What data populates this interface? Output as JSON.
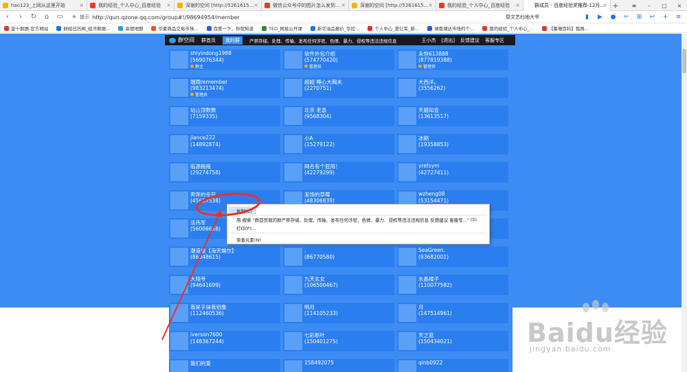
{
  "browser": {
    "tabs": [
      {
        "label": "hao123_上网从这里开始",
        "color": "#f5b400"
      },
      {
        "label": "我的经验_个人中心_百度经验",
        "color": "#e23b2e"
      },
      {
        "label": "深谢的空间 [http://526161584.qzone.qq.com]",
        "color": "#f5b400"
      },
      {
        "label": "微信公众号中的图片怎么发到电脑上_百度经验",
        "color": "#e23b2e"
      },
      {
        "label": "深谢的空间 [http://526161584.qzone.qq.com]",
        "color": "#f5b400"
      },
      {
        "label": "我的经验_个人中心_百度经验",
        "color": "#e23b2e"
      },
      {
        "label": "群成员 - 百度经验奖推荐-12月 - 群",
        "color": "#ffffff",
        "active": true
      }
    ],
    "tab_add": "+",
    "window_controls": [
      "≡",
      "–",
      "□",
      "×"
    ],
    "nav": {
      "back": "‹",
      "forward": "›",
      "reload": "↻",
      "home": "⌂",
      "reader": "▭"
    },
    "address": {
      "tip": "提示",
      "url": "http://qun.qzone.qq.com/group#!/98694954/member"
    },
    "search": {
      "value": "昼文艺扫地大爷"
    },
    "toolbar_icons": [
      "▮",
      "▶",
      "●",
      "✂",
      "⊞",
      "↩",
      "+",
      "≡"
    ],
    "bookmarks": [
      {
        "label": "金十数据-官方网站",
        "color": "#d9362b"
      },
      {
        "label": "财经日历网_经济数据...",
        "color": "#1a73e8"
      },
      {
        "label": "高德地图",
        "color": "#2d9cdb"
      },
      {
        "label": "华夏商品交易市场...",
        "color": "#e8542e"
      },
      {
        "label": "百度一下，你就知道",
        "color": "#2a5bd7"
      },
      {
        "label": "TED_网易公开课",
        "color": "#2c8a3c"
      },
      {
        "label": "新华油品报价_华控...",
        "color": "#1a73e8"
      },
      {
        "label": "个人中心_爱亿军_新...",
        "color": "#d9362b"
      },
      {
        "label": "湖南湖达市场的个...",
        "color": "#2a5bd7"
      },
      {
        "label": "我的经验_个人中心_...",
        "color": "#e23b2e"
      },
      {
        "label": "【鲁珊百科】我再...",
        "color": "#d9362b"
      }
    ]
  },
  "qzone_nav": {
    "logo": "群空间",
    "items": [
      "群首页",
      "我的群",
      "产禁存储、处理、传输、发布任何涉密、色情、暴力、侵权等违法违规信息"
    ],
    "right": [
      "王小杰",
      "[退出]",
      "反馈建议",
      "客服专区"
    ]
  },
  "members": [
    [
      {
        "name": "shiyindong1988",
        "qq": "(569076344)",
        "role": "群主"
      },
      {
        "name": "软件外包介绍",
        "qq": "(574770420)",
        "role": "管理员"
      },
      {
        "name": "永恒613888",
        "qq": "(877819388)",
        "role": "管理员"
      }
    ],
    [
      {
        "name": "烟雨remember",
        "qq": "(983213474)",
        "role": "管理员"
      },
      {
        "name": "超超 睡心大胸夫",
        "qq": "(2270751)",
        "role": ""
      },
      {
        "name": "大西洋。",
        "qq": "(3556262)",
        "role": ""
      }
    ],
    [
      {
        "name": "站山顶数数",
        "qq": "(7159335)",
        "role": ""
      },
      {
        "name": "北京 老县",
        "qq": "(9568304)",
        "role": ""
      },
      {
        "name": "天猫知音",
        "qq": "(13613517)",
        "role": ""
      }
    ],
    [
      {
        "name": "jiance222",
        "qq": "(14892874)",
        "role": ""
      },
      {
        "name": "小A",
        "qq": "(15279122)",
        "role": ""
      },
      {
        "name": "冰期",
        "qq": "(19358853)",
        "role": ""
      }
    ],
    [
      {
        "name": "临源拖拖",
        "qq": "(29274758)",
        "role": ""
      },
      {
        "name": "网名有个屁用！",
        "qq": "(42279299)",
        "role": ""
      },
      {
        "name": "yretsym",
        "qq": "(42727411)",
        "role": ""
      }
    ],
    [
      {
        "name": "奔奔的冬狂",
        "qq": "(45607538)",
        "role": ""
      },
      {
        "name": "发饰的草莓",
        "qq": "(48306839)",
        "role": ""
      },
      {
        "name": "wzheng08",
        "qq": "(53154471)",
        "role": ""
      }
    ],
    [
      {
        "name": "活伟军",
        "qq": "(56006658)",
        "role": ""
      },
      {
        "name": "",
        "qq": "",
        "role": ""
      },
      {
        "name": "",
        "qq": "",
        "role": ""
      }
    ],
    [
      {
        "name": "潮道提【海天嫦尔】",
        "qq": "(86048615)",
        "role": ""
      },
      {
        "name": ".",
        "qq": "(86770580)",
        "role": ""
      },
      {
        "name": "SeaGreen.",
        "qq": "(93682001)",
        "role": ""
      }
    ],
    [
      {
        "name": "大晓爷",
        "qq": "(94641699)",
        "role": ""
      },
      {
        "name": "九天玄女",
        "qq": "(106500467)",
        "role": ""
      },
      {
        "name": "水晶橘子",
        "qq": "(110077582)",
        "role": ""
      }
    ],
    [
      {
        "name": "我是字抹我铝像",
        "qq": "(112460536)",
        "role": ""
      },
      {
        "name": "明月",
        "qq": "(114105233)",
        "role": ""
      },
      {
        "name": "月",
        "qq": "(147514961)",
        "role": ""
      }
    ],
    [
      {
        "name": "iverson7600",
        "qq": "(148367244)",
        "role": ""
      },
      {
        "name": "七彩新叶",
        "qq": "(150401275)",
        "role": ""
      },
      {
        "name": "天之篮",
        "qq": "(150434021)",
        "role": ""
      }
    ],
    [
      {
        "name": "我们的爱",
        "qq": "",
        "role": ""
      },
      {
        "name": "158492075",
        "qq": "",
        "role": ""
      },
      {
        "name": "qinb0922",
        "qq": "",
        "role": ""
      }
    ]
  ],
  "context_menu": {
    "items": [
      {
        "label": "复制(C)",
        "highlight": true
      },
      {
        "label": "用 搜索 \"群首页我的群严禁存储、处理、传输、发布任何涉密、色情、暴力、侵权等违法违规信息 反馈建议 客服专...\"",
        "key": "(S)"
      },
      {
        "label": "打印(P)..."
      },
      {
        "label": "审查元素(N)"
      }
    ]
  },
  "watermark": {
    "big": "Baidu经验",
    "small": "jingyan.baidu.com"
  },
  "colors": {
    "page_bg": "#3d8cf3",
    "annotation_red": "#e8322a"
  }
}
